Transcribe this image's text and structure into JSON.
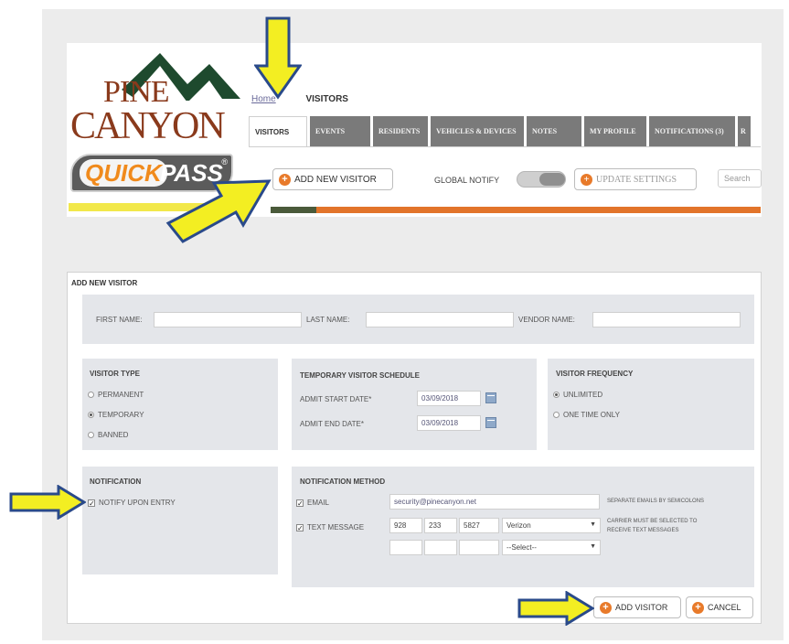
{
  "brand": {
    "line1": "PINE",
    "line2": "CANYON",
    "quick": "QUICK",
    "pass": "PASS",
    "reg": "®"
  },
  "breadcrumb": {
    "home": "Home",
    "current": "VISITORS"
  },
  "tabs": [
    "VISITORS",
    "EVENTS",
    "RESIDENTS",
    "VEHICLES & DEVICES",
    "NOTES",
    "MY PROFILE",
    "NOTIFICATIONS (3)",
    "R"
  ],
  "toolbar": {
    "add_new_visitor": "ADD NEW VISITOR",
    "global_notify": "GLOBAL NOTIFY",
    "update_settings": "UPDATE SETTINGS",
    "search_placeholder": "Search"
  },
  "form": {
    "title": "ADD NEW VISITOR",
    "first_name_label": "FIRST NAME:",
    "last_name_label": "LAST NAME:",
    "vendor_name_label": "VENDOR NAME:",
    "visitor_type": {
      "title": "VISITOR TYPE",
      "options": [
        "PERMANENT",
        "TEMPORARY",
        "BANNED"
      ],
      "selected": "TEMPORARY"
    },
    "schedule": {
      "title": "TEMPORARY VISITOR SCHEDULE",
      "start_label": "ADMIT START DATE*",
      "start_value": "03/09/2018",
      "end_label": "ADMIT END DATE*",
      "end_value": "03/09/2018"
    },
    "frequency": {
      "title": "VISITOR FREQUENCY",
      "options": [
        "UNLIMITED",
        "ONE TIME ONLY"
      ],
      "selected": "UNLIMITED"
    },
    "notification": {
      "title": "NOTIFICATION",
      "notify_label": "NOTIFY UPON ENTRY"
    },
    "method": {
      "title": "NOTIFICATION METHOD",
      "email_label": "EMAIL",
      "email_value": "security@pinecanyon.net",
      "email_hint": "SEPARATE EMAILS BY SEMICOLONS",
      "text_label": "TEXT MESSAGE",
      "phone1": "928",
      "phone2": "233",
      "phone3": "5827",
      "carrier": "Verizon",
      "carrier_hint_1": "CARRIER MUST BE SELECTED TO",
      "carrier_hint_2": "RECEIVE TEXT MESSAGES",
      "carrier2": "--Select--"
    },
    "add_visitor": "ADD VISITOR",
    "cancel": "CANCEL"
  },
  "colors": {
    "accent": "#e87a2a",
    "arrow": "#f3ee22",
    "arrow_outline": "#2a4a8a"
  }
}
